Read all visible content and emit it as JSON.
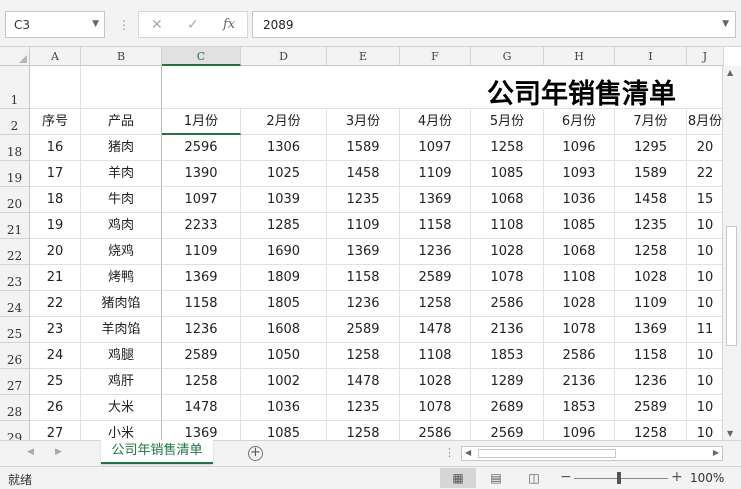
{
  "formula_bar": {
    "cell_ref": "C3",
    "separator": "⋮",
    "cancel_icon": "✕",
    "enter_icon": "✓",
    "fx_label": "fx",
    "value": "2089",
    "dropdown_icon": "⌄"
  },
  "sheet": {
    "columns": [
      "A",
      "B",
      "C",
      "D",
      "E",
      "F",
      "G",
      "H",
      "I",
      "J"
    ],
    "selected_column": "C",
    "title": "公司年销售清单",
    "header_row_numbers": [
      "1",
      "2"
    ],
    "headers": [
      "序号",
      "产品",
      "1月份",
      "2月份",
      "3月份",
      "4月份",
      "5月份",
      "6月份",
      "7月份",
      "8月份"
    ],
    "rows": [
      {
        "row": "18",
        "cells": [
          "16",
          "猪肉",
          "2596",
          "1306",
          "1589",
          "1097",
          "1258",
          "1096",
          "1295",
          "20"
        ]
      },
      {
        "row": "19",
        "cells": [
          "17",
          "羊肉",
          "1390",
          "1025",
          "1458",
          "1109",
          "1085",
          "1093",
          "1589",
          "22"
        ]
      },
      {
        "row": "20",
        "cells": [
          "18",
          "牛肉",
          "1097",
          "1039",
          "1235",
          "1369",
          "1068",
          "1036",
          "1458",
          "15"
        ]
      },
      {
        "row": "21",
        "cells": [
          "19",
          "鸡肉",
          "2233",
          "1285",
          "1109",
          "1158",
          "1108",
          "1085",
          "1235",
          "10"
        ]
      },
      {
        "row": "22",
        "cells": [
          "20",
          "烧鸡",
          "1109",
          "1690",
          "1369",
          "1236",
          "1028",
          "1068",
          "1258",
          "10"
        ]
      },
      {
        "row": "23",
        "cells": [
          "21",
          "烤鸭",
          "1369",
          "1809",
          "1158",
          "2589",
          "1078",
          "1108",
          "1028",
          "10"
        ]
      },
      {
        "row": "24",
        "cells": [
          "22",
          "猪肉馅",
          "1158",
          "1805",
          "1236",
          "1258",
          "2586",
          "1028",
          "1109",
          "10"
        ]
      },
      {
        "row": "25",
        "cells": [
          "23",
          "羊肉馅",
          "1236",
          "1608",
          "2589",
          "1478",
          "2136",
          "1078",
          "1369",
          "11"
        ]
      },
      {
        "row": "26",
        "cells": [
          "24",
          "鸡腿",
          "2589",
          "1050",
          "1258",
          "1108",
          "1853",
          "2586",
          "1158",
          "10"
        ]
      },
      {
        "row": "27",
        "cells": [
          "25",
          "鸡肝",
          "1258",
          "1002",
          "1478",
          "1028",
          "1289",
          "2136",
          "1236",
          "10"
        ]
      },
      {
        "row": "28",
        "cells": [
          "26",
          "大米",
          "1478",
          "1036",
          "1235",
          "1078",
          "2689",
          "1853",
          "2589",
          "10"
        ]
      },
      {
        "row": "29",
        "cells": [
          "27",
          "小米",
          "1369",
          "1085",
          "1258",
          "2586",
          "2569",
          "1096",
          "1258",
          "10"
        ]
      }
    ]
  },
  "tabs": {
    "prev_icon": "◀",
    "next_icon": "▶",
    "sheet_name": "公司年销售清单",
    "add_icon": "+",
    "dots": "⋮"
  },
  "status": {
    "ready": "就绪",
    "zoom_level": "100%",
    "zoom_minus": "−",
    "zoom_plus": "+",
    "view_normal_icon": "▦",
    "view_layout_icon": "▤",
    "view_break_icon": "◫"
  }
}
